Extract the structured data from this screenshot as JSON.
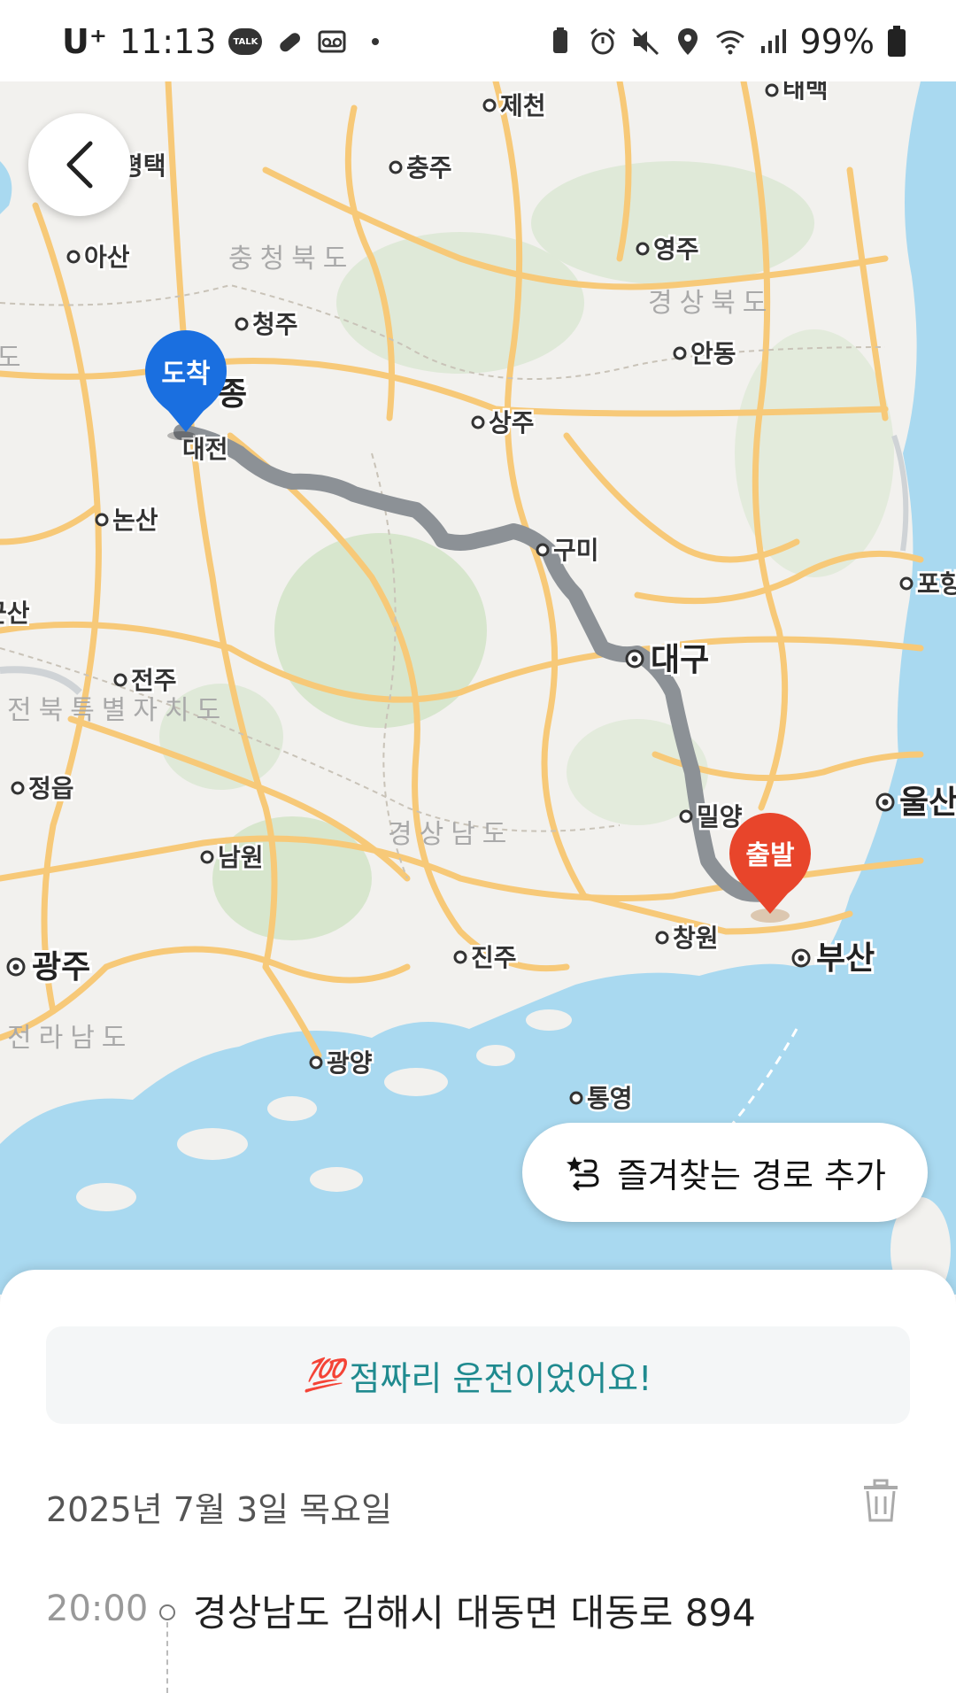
{
  "status_bar": {
    "carrier": "U⁺",
    "time": "11:13",
    "notif_talk": "TALK",
    "battery_pct": "99%"
  },
  "map": {
    "labels": {
      "pyeongtaek": "평택",
      "jecheon": "제천",
      "taebaek": "태백",
      "chungju": "충주",
      "asan": "아산",
      "chungbuk": "충청북도",
      "yeongju": "영주",
      "gyeongbuk": "경상북도",
      "cheongju": "청주",
      "andong": "안동",
      "sejong": "종",
      "sangju": "상주",
      "daejeon": "대전",
      "nonsan": "논산",
      "gumi": "구미",
      "pohang": "포항",
      "gunsan": "군산",
      "daegu": "대구",
      "jeonju": "전주",
      "jeonbuk": "전북특별자치도",
      "jeongeup": "정읍",
      "miryang": "밀양",
      "ulsan": "울산",
      "gyeongnam": "경상남도",
      "namwon": "남원",
      "changwon": "창원",
      "busan": "부산",
      "gwangju": "광주",
      "jinju": "진주",
      "jeonnam": "전라남도",
      "gwangyang": "광양",
      "tongyeong": "통영",
      "do_fragment": "도"
    },
    "arrival_marker": "도착",
    "departure_marker": "출발"
  },
  "favorite_route_button": "즐겨찾는 경로 추가",
  "trip": {
    "banner_emoji": "💯",
    "banner_text": "점짜리 운전이었어요!",
    "date": "2025년 7월 3일 목요일",
    "start_time": "20:00",
    "start_address": "경상남도 김해시 대동면 대동로 894"
  },
  "colors": {
    "route": "#8c9196",
    "arrival": "#1a6fe0",
    "departure": "#e8452b",
    "sea": "#a9d9f0",
    "road": "#f7c978",
    "banner_text": "#1f8a8f"
  }
}
